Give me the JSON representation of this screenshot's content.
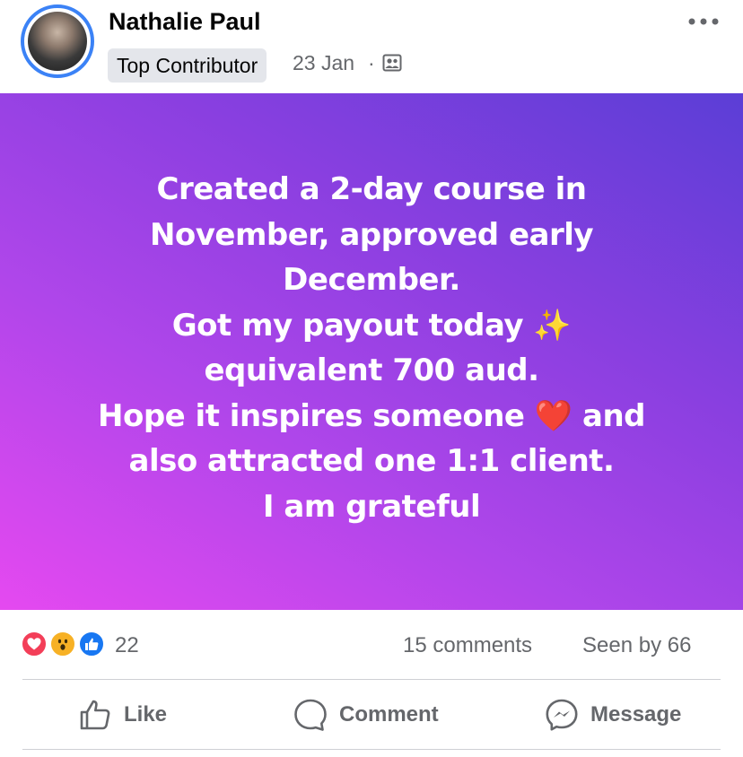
{
  "post": {
    "author": "Nathalie Paul",
    "badge": "Top Contributor",
    "date": "23 Jan",
    "separator": "·",
    "privacy_icon": "group-members-icon",
    "text": "Created a 2-day course in\nNovember, approved early\nDecember.\nGot my payout today ✨\nequivalent 700 aud.\nHope it inspires someone ❤️ and\nalso attracted one 1:1 client.\nI am grateful",
    "background_gradient": [
      "#e549f0",
      "#b046ea",
      "#8a3fe0",
      "#5b3ed6"
    ]
  },
  "stats": {
    "reactions": [
      "love-reaction-icon",
      "wow-reaction-icon",
      "like-reaction-icon"
    ],
    "reaction_count": "22",
    "comments": "15 comments",
    "seen": "Seen by 66"
  },
  "actions": {
    "like": "Like",
    "comment": "Comment",
    "message": "Message"
  },
  "colors": {
    "accent": "#1877f2",
    "secondary_text": "#65676b",
    "badge_bg": "#e4e6eb",
    "avatar_ring": "#3b82f6"
  }
}
